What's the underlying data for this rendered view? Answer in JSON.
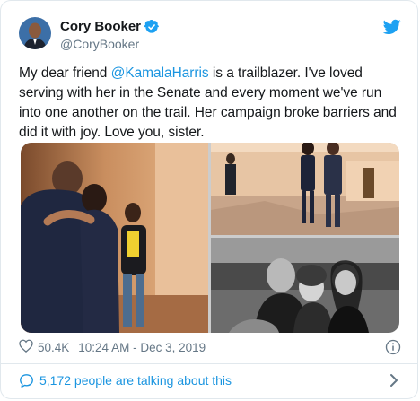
{
  "author": {
    "display_name": "Cory Booker",
    "handle": "@CoryBooker",
    "verified": true
  },
  "tweet": {
    "text_before": "My dear friend ",
    "mention": "@KamalaHarris",
    "text_after": " is a trailblazer. I've loved serving with her in the Senate and every moment we've run into one another on the trail. Her campaign broke barriers and did it with joy. Love you, sister."
  },
  "media": {
    "photo_count": 3
  },
  "meta": {
    "likes": "50.4K",
    "timestamp": "10:24 AM - Dec 3, 2019"
  },
  "conversation": {
    "label": "5,172 people are talking about this"
  },
  "colors": {
    "accent": "#1b95e0",
    "text": "#14171a",
    "secondary": "#657786",
    "border": "#e1e8ed"
  },
  "icons": [
    "twitter-bird-icon",
    "verified-badge-icon",
    "heart-icon",
    "info-icon",
    "speech-bubble-icon",
    "chevron-right-icon"
  ]
}
